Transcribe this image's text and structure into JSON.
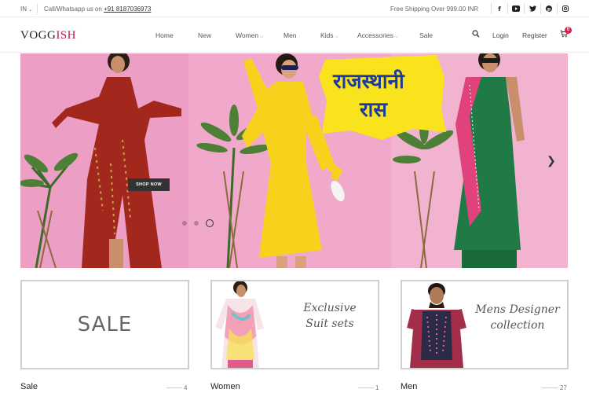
{
  "topbar": {
    "region": "IN",
    "contact_prefix": "Call/Whatsapp us on",
    "contact_phone": "+91 8187036973",
    "shipping": "Free Shipping Over 999.00 INR"
  },
  "header": {
    "logo_main": "VOGG",
    "logo_accent": "ISH",
    "nav": [
      {
        "label": "Home"
      },
      {
        "label": "New"
      },
      {
        "label": "Women"
      },
      {
        "label": "Men"
      },
      {
        "label": "Kids"
      },
      {
        "label": "Accessories"
      },
      {
        "label": "Sale"
      }
    ],
    "login": "Login",
    "register": "Register",
    "cart_count": "0"
  },
  "hero": {
    "banner_text_line1": "राजस्थानी",
    "banner_text_line2": "रास",
    "cta": "SHOP NOW"
  },
  "categories": [
    {
      "label": "Sale",
      "count": "4",
      "tile_text": "SALE"
    },
    {
      "label": "Women",
      "count": "1",
      "tile_text_line1": "Exclusive",
      "tile_text_line2": "Suit sets"
    },
    {
      "label": "Men",
      "count": "27",
      "tile_text_line1": "Mens Designer",
      "tile_text_line2": "collection"
    }
  ],
  "colors": {
    "brand_accent": "#c4135c",
    "hero_bg": "#ee95c0",
    "badge": "#e8174f"
  }
}
